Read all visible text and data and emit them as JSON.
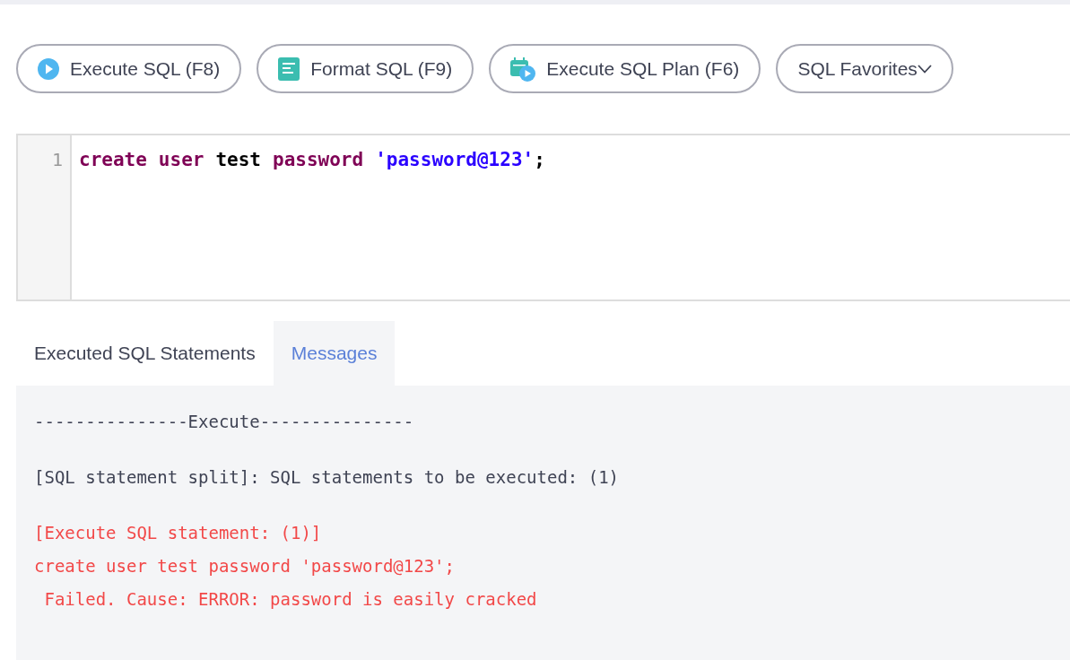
{
  "toolbar": {
    "buttons": [
      {
        "label": "Execute SQL (F8)",
        "kind": "execute"
      },
      {
        "label": "Format SQL (F9)",
        "kind": "format"
      },
      {
        "label": "Execute SQL Plan (F6)",
        "kind": "plan"
      },
      {
        "label": "SQL Favorites",
        "kind": "dropdown"
      }
    ]
  },
  "editor": {
    "lines": [
      {
        "number": "1",
        "tokens": [
          {
            "text": "create",
            "kind": "keyword"
          },
          {
            "text": "user",
            "kind": "keyword"
          },
          {
            "text": "test",
            "kind": "plain"
          },
          {
            "text": "password",
            "kind": "keyword"
          },
          {
            "text": "'password@123'",
            "kind": "string"
          },
          {
            "text": ";",
            "kind": "punct"
          }
        ]
      }
    ]
  },
  "tabs": [
    {
      "label": "Executed SQL Statements",
      "selected": false
    },
    {
      "label": "Messages",
      "selected": true
    }
  ],
  "messages": [
    {
      "text": "---------------Execute---------------",
      "kind": "normal"
    },
    {
      "text": "[SQL statement split]: SQL statements to be executed: (1)",
      "kind": "normal"
    },
    {
      "text": "[Execute SQL statement: (1)]",
      "kind": "error"
    },
    {
      "text": "create user test password 'password@123';",
      "kind": "error"
    },
    {
      "text": " Failed. Cause: ERROR: password is easily cracked",
      "kind": "error"
    }
  ]
}
